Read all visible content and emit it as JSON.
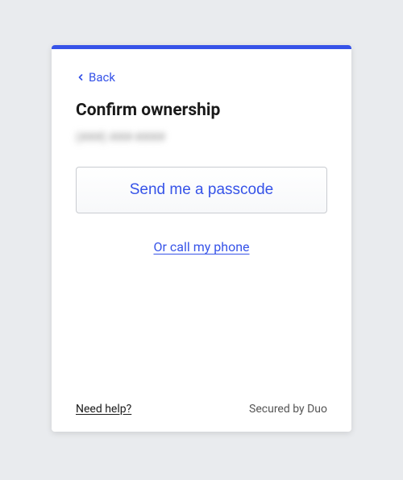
{
  "nav": {
    "back_label": "Back"
  },
  "header": {
    "title": "Confirm ownership",
    "phone_masked": "(###) ###-####"
  },
  "actions": {
    "primary_label": "Send me a passcode",
    "secondary_label": "Or call my phone"
  },
  "footer": {
    "help_label": "Need help?",
    "secured_label": "Secured by Duo"
  },
  "colors": {
    "accent": "#3653e8"
  }
}
